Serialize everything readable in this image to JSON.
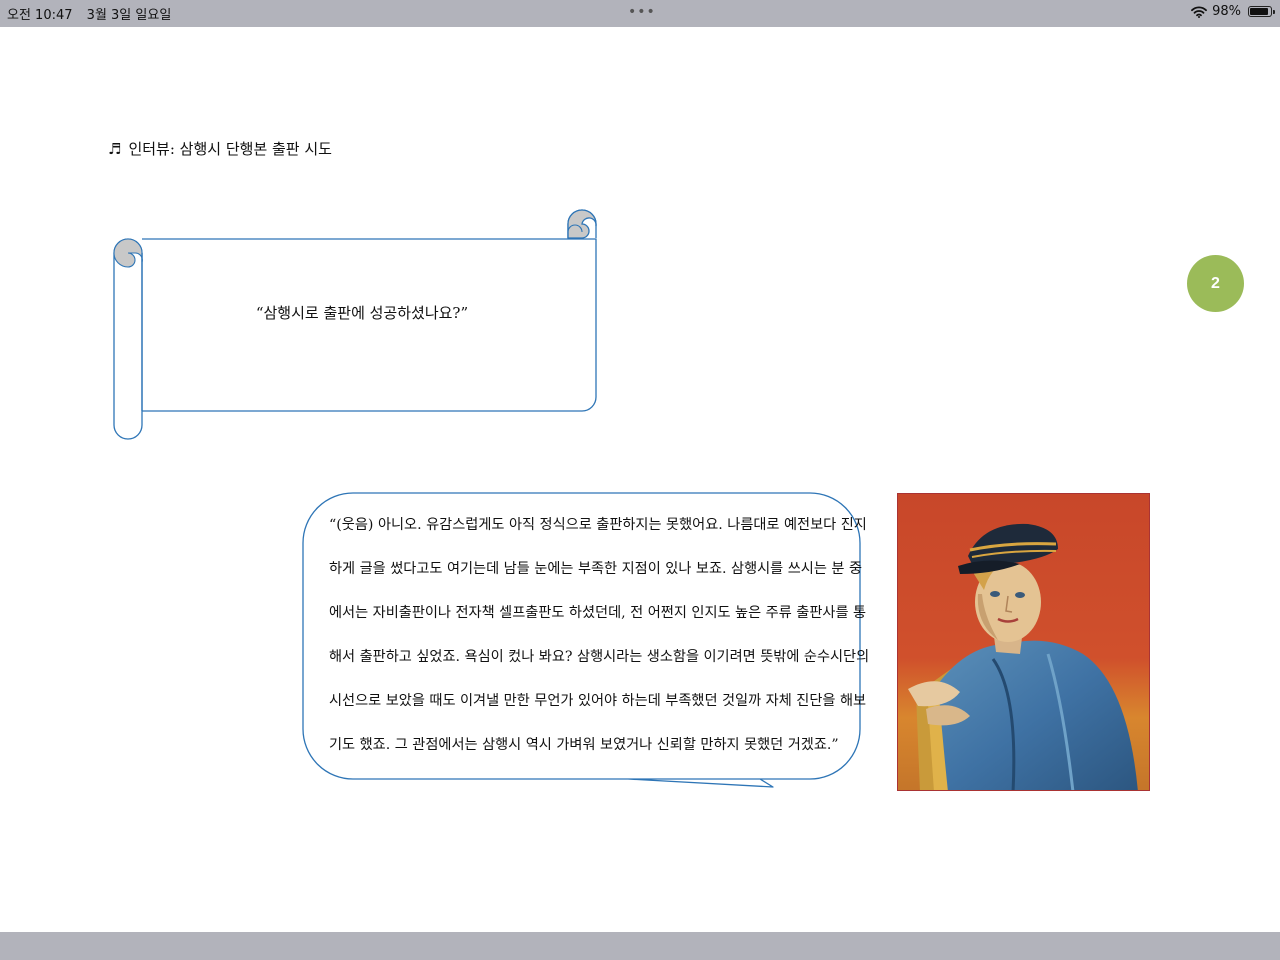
{
  "status_bar": {
    "time": "오전 10:47",
    "date": "3월 3일 일요일",
    "dots": "•••",
    "battery": "98%",
    "icons": [
      "wifi-icon",
      "battery-icon"
    ]
  },
  "heading": {
    "icon": "♬",
    "text": "인터뷰: 삼행시 단행본 출판 시도"
  },
  "scroll": {
    "question": "“삼행시로 출판에 성공하셨나요?”"
  },
  "page_badge": "2",
  "answer_lines": [
    "“(웃음) 아니오. 유감스럽게도 아직 정식으로 출판하지는 못했어요. 나름대로 예전보다 진지",
    "하게 글을 썼다고도 여기는데 남들 눈에는 부족한 지점이 있나 보죠. 삼행시를 쓰시는 분 중",
    "에서는 자비출판이나 전자책 셀프출판도 하셨던데, 전 어쩐지 인지도 높은 주류 출판사를 통",
    "해서 출판하고 싶었죠. 욕심이 컸나 봐요? 삼행시라는 생소함을 이기려면 뜻밖에 순수시단의",
    "시선으로 보았을 때도 이겨낼 만한 무언가 있어야 하는데 부족했던 것일까 자체 진단을 해보",
    "기도 했죠. 그 관점에서는 삼행시 역시 가벼워 보였거나 신뢰할 만하지 못했던 거겠죠.”"
  ],
  "colors": {
    "status_bar": "#b2b3bb",
    "outline": "#2e75b6",
    "scroll_curl": "#c8c8c8",
    "badge": "#9bbb59"
  }
}
